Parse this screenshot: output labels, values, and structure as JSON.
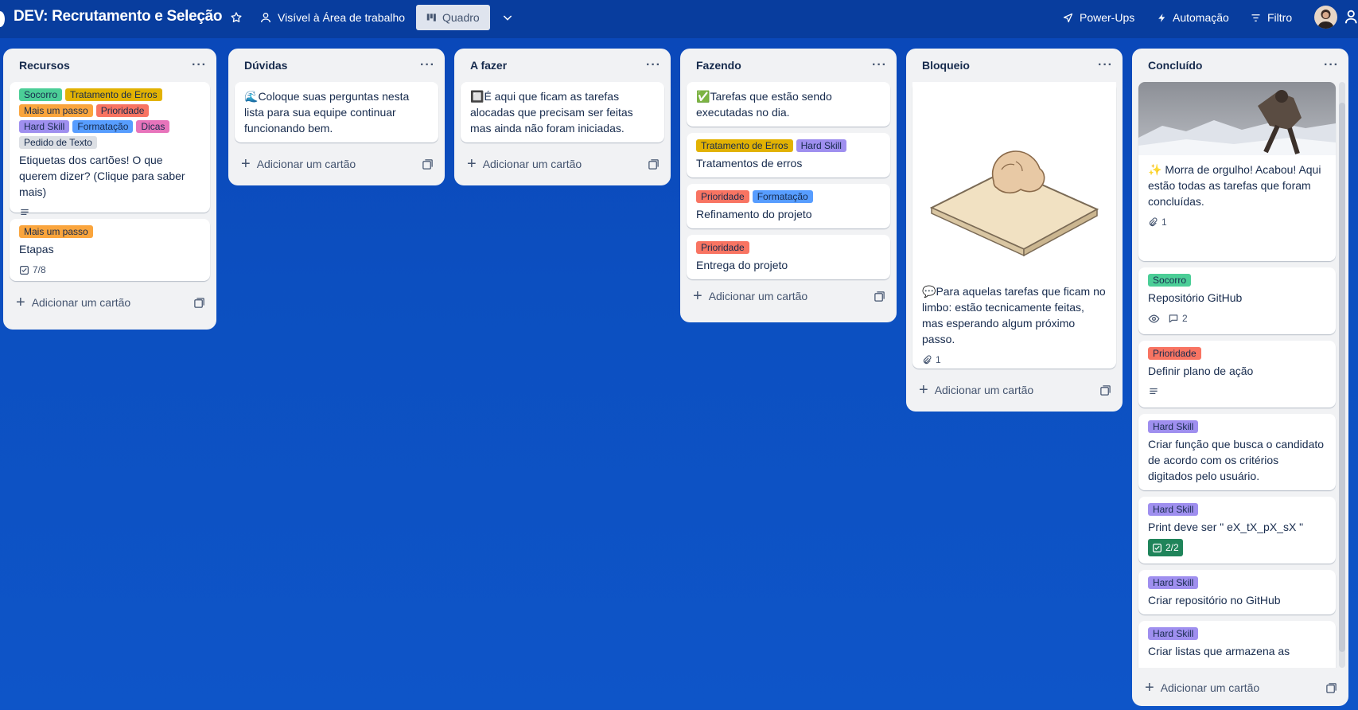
{
  "topbar": {
    "title": "DEV: Recrutamento e Seleção",
    "visibility": "Visível à Área de trabalho",
    "view": "Quadro",
    "power_ups": "Power-Ups",
    "automation": "Automação",
    "filter": "Filtro"
  },
  "colors": {
    "green": "#4bce97",
    "yellow": "#e2b203",
    "orange": "#faa53d",
    "red": "#f87462",
    "purple": "#9f8fef",
    "blue": "#579dff",
    "pink": "#e774bb",
    "gray": "#dcdfe4"
  },
  "add_card_label": "Adicionar um cartão",
  "lists": [
    {
      "title": "Recursos",
      "cards": [
        {
          "labels": [
            {
              "text": "Socorro",
              "color": "green"
            },
            {
              "text": "Tratamento de Erros",
              "color": "yellow"
            },
            {
              "text": "Mais um passo",
              "color": "orange"
            },
            {
              "text": "Prioridade",
              "color": "red"
            },
            {
              "text": "Hard Skill",
              "color": "purple"
            },
            {
              "text": "Formatação",
              "color": "blue"
            },
            {
              "text": "Dicas",
              "color": "pink"
            },
            {
              "text": "Pedido de Texto",
              "color": "gray"
            }
          ],
          "title": "Etiquetas dos cartões! O que querem dizer? (Clique para saber mais)",
          "description_icon": "description-icon"
        },
        {
          "labels": [
            {
              "text": "Mais um passo",
              "color": "orange"
            }
          ],
          "title": "Etapas",
          "checklist": "7/8"
        }
      ]
    },
    {
      "title": "Dúvidas",
      "cards": [
        {
          "emoji": "🌊",
          "title": "Coloque suas perguntas nesta lista para sua equipe continuar funcionando bem."
        }
      ]
    },
    {
      "title": "A fazer",
      "cards": [
        {
          "emoji": "🔲",
          "title": "É aqui que ficam as tarefas alocadas que precisam ser feitas mas ainda não foram iniciadas."
        }
      ]
    },
    {
      "title": "Fazendo",
      "cards": [
        {
          "emoji": "✅",
          "title": "Tarefas que estão sendo executadas no dia."
        },
        {
          "labels": [
            {
              "text": "Tratamento de Erros",
              "color": "yellow"
            },
            {
              "text": "Hard Skill",
              "color": "purple"
            }
          ],
          "title": "Tratamentos de erros"
        },
        {
          "labels": [
            {
              "text": "Prioridade",
              "color": "red"
            },
            {
              "text": "Formatação",
              "color": "blue"
            }
          ],
          "title": "Refinamento do projeto"
        },
        {
          "labels": [
            {
              "text": "Prioridade",
              "color": "red"
            }
          ],
          "title": "Entrega do projeto"
        }
      ]
    },
    {
      "title": "Bloqueio",
      "cards": [
        {
          "emoji": "💬",
          "title": "Para aquelas tarefas que ficam no limbo: estão tecnicamente feitas, mas esperando algum próximo passo.",
          "attachments": "1"
        }
      ]
    },
    {
      "title": "Concluído",
      "cards": [
        {
          "emoji": "✨",
          "title": "Morra de orgulho! Acabou! Aqui estão todas as tarefas que foram concluídas.",
          "attachments": "1"
        },
        {
          "labels": [
            {
              "text": "Socorro",
              "color": "green"
            }
          ],
          "title": "Repositório GitHub",
          "comments": "2"
        },
        {
          "labels": [
            {
              "text": "Prioridade",
              "color": "red"
            }
          ],
          "title": "Definir plano de ação"
        },
        {
          "labels": [
            {
              "text": "Hard Skill",
              "color": "purple"
            }
          ],
          "title": "Criar função que busca o candidato de acordo com os critérios digitados pelo usuário."
        },
        {
          "labels": [
            {
              "text": "Hard Skill",
              "color": "purple"
            }
          ],
          "title": "Print deve ser \" eX_tX_pX_sX \"",
          "checklist": "2/2"
        },
        {
          "labels": [
            {
              "text": "Hard Skill",
              "color": "purple"
            }
          ],
          "title": "Criar repositório no GitHub"
        },
        {
          "labels": [
            {
              "text": "Hard Skill",
              "color": "purple"
            }
          ],
          "title": "Criar listas que armazena as"
        }
      ]
    }
  ]
}
